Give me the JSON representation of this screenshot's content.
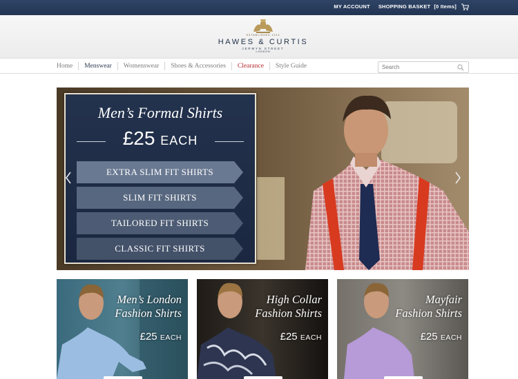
{
  "topbar": {
    "my_account": "MY ACCOUNT",
    "basket_label": "SHOPPING BASKET",
    "basket_count": "[0 Items]",
    "cart_icon": "cart-icon"
  },
  "header": {
    "established": "ESTABLISHED 1913",
    "brand": "HAWES & CURTIS",
    "street": "JERMYN STREET",
    "city": "LONDON"
  },
  "nav": {
    "items": [
      {
        "label": "Home"
      },
      {
        "label": "Menswear"
      },
      {
        "label": "Womenswear"
      },
      {
        "label": "Shoes & Accessories"
      },
      {
        "label": "Clearance"
      },
      {
        "label": "Style Guide"
      }
    ],
    "active": "Menswear",
    "search_placeholder": "Search",
    "search_icon": "search-icon"
  },
  "hero": {
    "title": "Men’s Formal Shirts",
    "price": "£25",
    "each": "EACH",
    "links": [
      "EXTRA SLIM FIT SHIRTS",
      "SLIM FIT SHIRTS",
      "TAILORED FIT SHIRTS",
      "CLASSIC FIT SHIRTS"
    ],
    "prev_icon": "chevron-left-icon",
    "next_icon": "chevron-right-icon"
  },
  "tiles": [
    {
      "title_1": "Men’s London",
      "title_2": "Fashion Shirts",
      "price": "£25",
      "each": "EACH"
    },
    {
      "title_1": "High Collar",
      "title_2": "Fashion Shirts",
      "price": "£25",
      "each": "EACH"
    },
    {
      "title_1": "Mayfair",
      "title_2": "Fashion Shirts",
      "price": "£25",
      "each": "EACH"
    }
  ],
  "colors": {
    "topbar": "#223452",
    "navy_panel": "#1b2740",
    "clearance": "#b5272d"
  }
}
